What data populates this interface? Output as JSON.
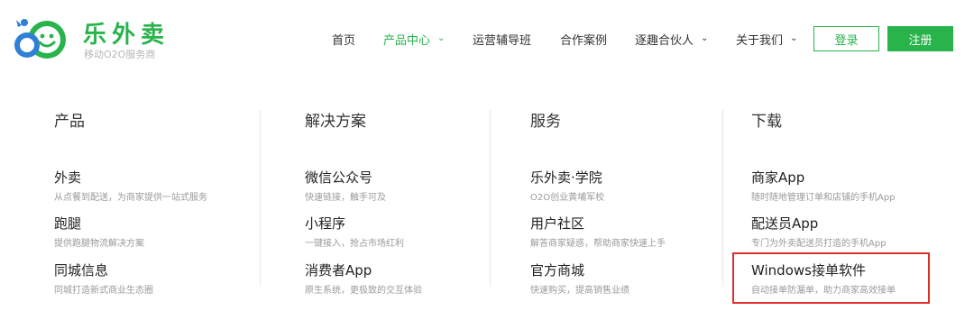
{
  "brand": {
    "name": "乐外卖",
    "tagline": "移动O2O服务商",
    "green": "#28b34b",
    "blue": "#2f7fd6"
  },
  "nav": {
    "items": [
      {
        "label": "首页"
      },
      {
        "label": "产品中心",
        "active": true,
        "chevron": "chevron-down-icon"
      },
      {
        "label": "运营辅导班"
      },
      {
        "label": "合作案例"
      },
      {
        "label": "逐趣合伙人",
        "chevron": "chevron-down-icon"
      },
      {
        "label": "关于我们",
        "chevron": "chevron-down-icon"
      }
    ],
    "login_label": "登录",
    "register_label": "注册"
  },
  "menu": {
    "columns": [
      {
        "title": "产品",
        "items": [
          {
            "title": "外卖",
            "desc": "从点餐到配送，为商家提供一站式服务"
          },
          {
            "title": "跑腿",
            "desc": "提供跑腿物流解决方案"
          },
          {
            "title": "同城信息",
            "desc": "同城打造新式商业生态圈"
          }
        ]
      },
      {
        "title": "解决方案",
        "items": [
          {
            "title": "微信公众号",
            "desc": "快速链接，触手可及"
          },
          {
            "title": "小程序",
            "desc": "一键接入，抢占市场红利"
          },
          {
            "title": "消费者App",
            "desc": "原生系统，更极致的交互体验"
          }
        ]
      },
      {
        "title": "服务",
        "items": [
          {
            "title": "乐外卖·学院",
            "desc": "O2O创业黄埔军校"
          },
          {
            "title": "用户社区",
            "desc": "解答商家疑惑，帮助商家快速上手"
          },
          {
            "title": "官方商城",
            "desc": "快速购买，提高销售业绩"
          }
        ]
      },
      {
        "title": "下载",
        "items": [
          {
            "title": "商家App",
            "desc": "随时随地管理订单和店铺的手机App"
          },
          {
            "title": "配送员App",
            "desc": "专门为外卖配送员打造的手机App"
          },
          {
            "title": "Windows接单软件",
            "desc": "自动接单防漏单，助力商家高效接单",
            "highlighted": true,
            "highlight_color": "#e0302c"
          }
        ]
      }
    ]
  }
}
